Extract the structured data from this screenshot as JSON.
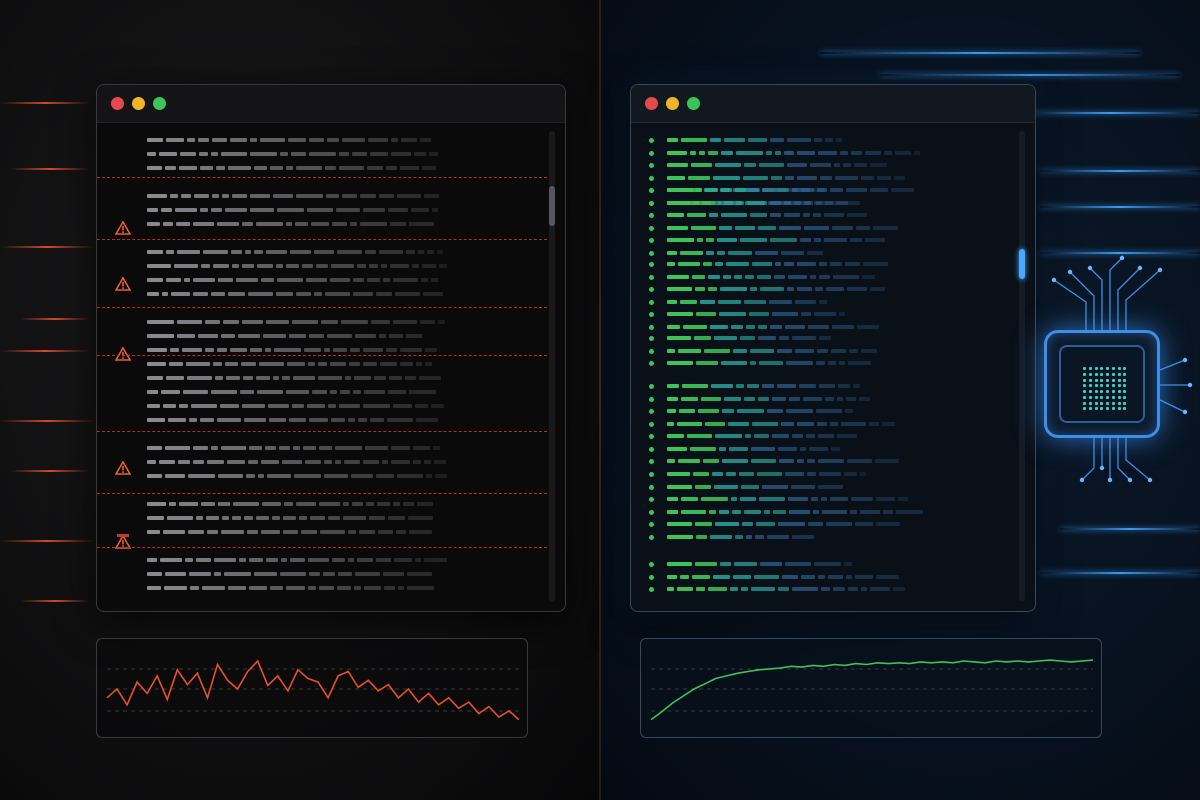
{
  "theme": {
    "bad_accent": "#e8502a",
    "good_accent": "#3cc35a",
    "blue_glow": "#4aa8ff"
  },
  "left_window": {
    "controls": [
      "close",
      "minimize",
      "maximize"
    ],
    "state": "errors",
    "icon": "warning-triangle-icon"
  },
  "right_window": {
    "controls": [
      "close",
      "minimize",
      "maximize"
    ],
    "state": "clean",
    "icon": "status-dot"
  },
  "left_chart": {
    "trend": "erratic-declining",
    "color": "#e8502a",
    "points": [
      30,
      40,
      22,
      48,
      35,
      55,
      28,
      62,
      45,
      58,
      30,
      68,
      50,
      40,
      60,
      72,
      44,
      55,
      38,
      62,
      52,
      48,
      30,
      55,
      60,
      42,
      50,
      38,
      45,
      30,
      40,
      25,
      35,
      22,
      30,
      18,
      25,
      12,
      20,
      8,
      15,
      5
    ]
  },
  "right_chart": {
    "trend": "rising-then-stable",
    "color": "#3cc35a",
    "points": [
      5,
      14,
      24,
      32,
      40,
      46,
      52,
      55,
      58,
      60,
      62,
      63,
      64,
      66,
      65,
      67,
      66,
      68,
      67,
      69,
      68,
      70,
      69,
      70,
      69,
      71,
      70,
      71,
      70,
      72,
      71,
      70,
      72,
      71,
      72,
      71,
      72,
      73,
      72,
      71,
      72,
      73
    ]
  }
}
